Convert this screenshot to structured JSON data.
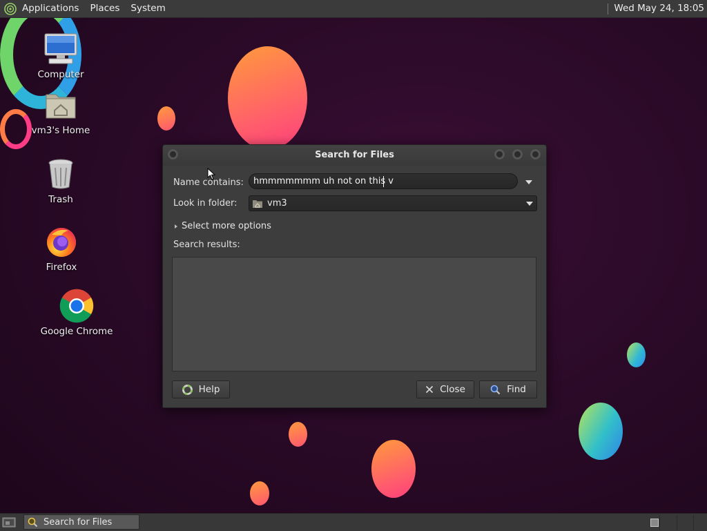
{
  "top_panel": {
    "menus": [
      "Applications",
      "Places",
      "System"
    ],
    "clock": "Wed May 24, 18:05"
  },
  "desktop": {
    "icons": [
      {
        "label": "Computer",
        "icon": "computer-icon"
      },
      {
        "label": "vm3's Home",
        "icon": "home-folder-icon"
      },
      {
        "label": "Trash",
        "icon": "trash-icon"
      },
      {
        "label": "Firefox",
        "icon": "firefox-icon"
      },
      {
        "label": "Google Chrome",
        "icon": "chrome-icon"
      }
    ]
  },
  "dialog": {
    "title": "Search for Files",
    "name_label": "Name contains:",
    "name_value": "hmmmmmmm uh not on this v",
    "folder_label": "Look in folder:",
    "folder_value": "vm3",
    "more_options": "Select more options",
    "results_label": "Search results:",
    "help_label": "Help",
    "close_label": "Close",
    "find_label": "Find"
  },
  "bottom_panel": {
    "task_label": "Search for Files"
  },
  "colors": {
    "panel": "#3b3b3b",
    "dialog_bg": "#3d3d3d",
    "desktop_bg": "#2b0a28",
    "find_icon": "#6aa8ff"
  }
}
